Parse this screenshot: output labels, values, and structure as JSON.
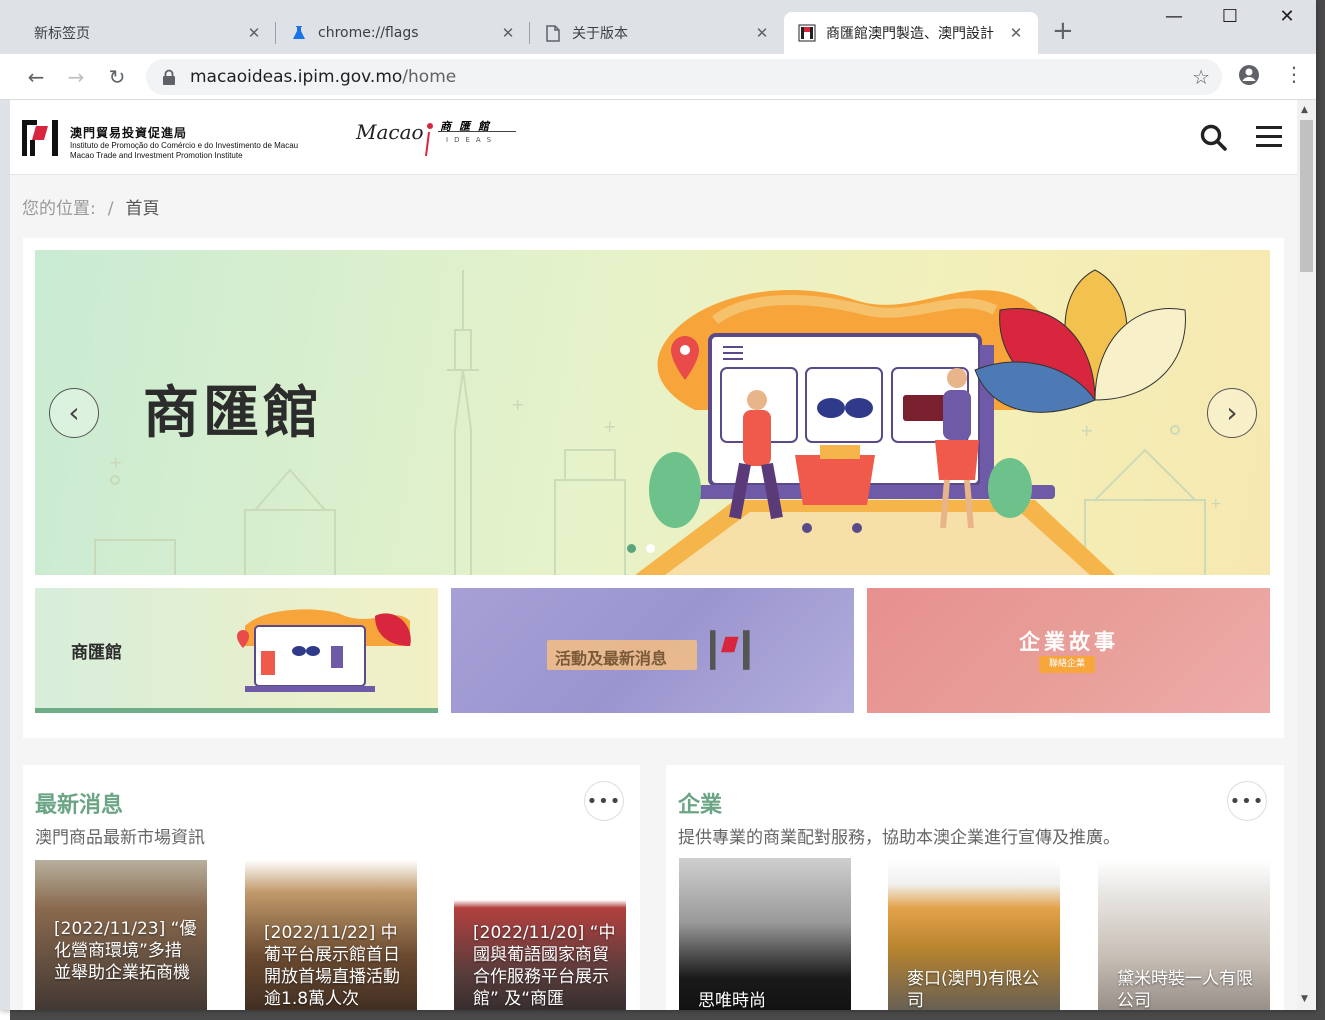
{
  "browser": {
    "tabs": [
      {
        "title": "新标签页"
      },
      {
        "title": "chrome://flags"
      },
      {
        "title": "关于版本"
      },
      {
        "title": "商匯館澳門製造、澳門設計"
      }
    ],
    "new_tab": "+",
    "address": {
      "host": "macaoideas.ipim.gov.mo",
      "path": "/home"
    }
  },
  "site": {
    "org_name_zh": "澳門貿易投資促進局",
    "org_name_pt": "Instituto de Promoção do Comércio e do Investimento de Macau",
    "org_name_en": "Macao Trade and Investment Promotion Institute",
    "brand_macao": "Macao",
    "brand_zh": "商匯館",
    "brand_ideas": "IDEAS",
    "breadcrumb_label": "您的位置:",
    "breadcrumb_sep": "/",
    "breadcrumb_current": "首頁"
  },
  "hero": {
    "title": "商匯館",
    "slide_count": 2,
    "active_slide": 0,
    "prev_label": "‹",
    "next_label": "›"
  },
  "cards": [
    {
      "label": "商匯館"
    },
    {
      "label": "活動及最新消息"
    },
    {
      "label": "企業故事",
      "sub": "聯絡企業"
    }
  ],
  "news": {
    "title": "最新消息",
    "subtitle": "澳門商品最新市場資訊",
    "more": "•••",
    "items": [
      {
        "caption": "[2022/11/23] “優化營商環境”多措並舉助企業拓商機"
      },
      {
        "caption": "[2022/11/22] 中葡平台展示館首日開放首場直播活動逾1.8萬人次"
      },
      {
        "caption": "[2022/11/20] “中國與葡語國家商貿合作服務平台展示館” 及“商匯"
      }
    ]
  },
  "enterprise": {
    "title": "企業",
    "subtitle": "提供專業的商業配對服務，協助本澳企業進行宣傳及推廣。",
    "more": "•••",
    "items": [
      {
        "caption": "思唯時尚"
      },
      {
        "caption": "麥口(澳門)有限公司"
      },
      {
        "caption": "黛米時裝一人有限公司"
      }
    ]
  },
  "colors": {
    "accent_green": "#6ba585",
    "logo_red": "#d7263d"
  }
}
